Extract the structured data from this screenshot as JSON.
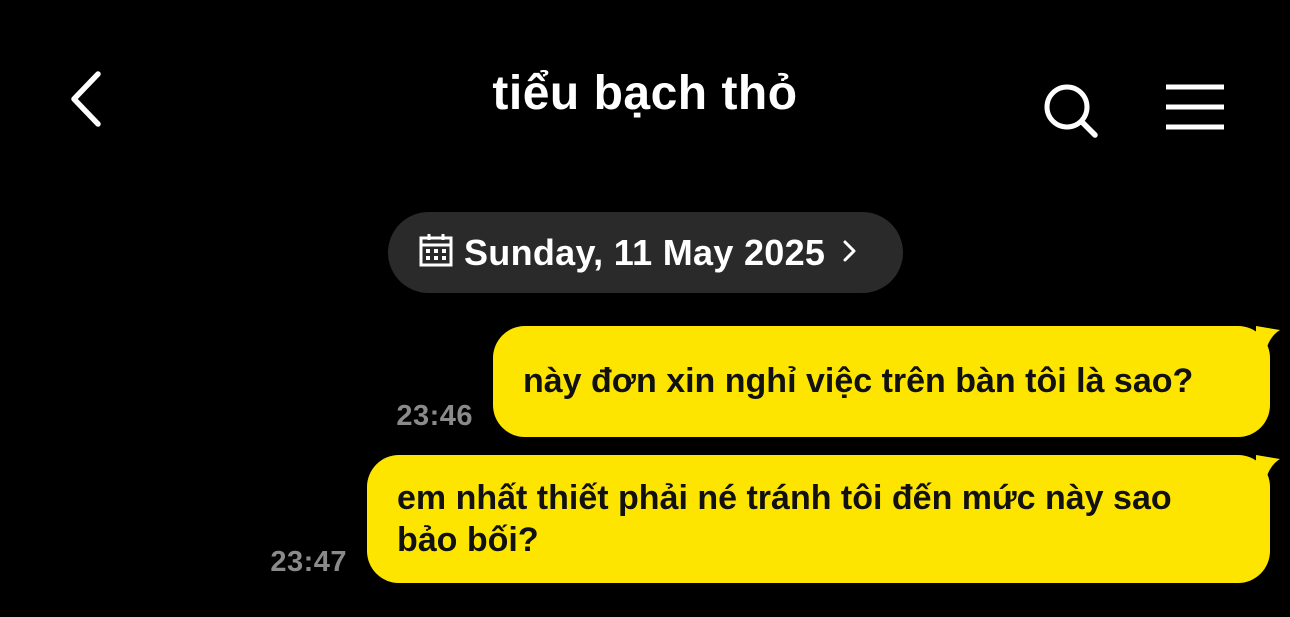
{
  "header": {
    "title": "tiểu bạch thỏ",
    "back_icon": "chevron-left-icon",
    "search_icon": "search-icon",
    "menu_icon": "hamburger-menu-icon"
  },
  "date_chip": {
    "label": "Sunday, 11 May 2025",
    "icon": "calendar-icon",
    "chevron": "chevron-right-icon"
  },
  "messages": [
    {
      "text": "này đơn xin nghỉ việc trên bàn tôi là sao?",
      "time": "23:46",
      "sender": "me"
    },
    {
      "text": "em nhất thiết phải né tránh tôi đến mức này sao bảo bối?",
      "time": "23:47",
      "sender": "me"
    }
  ],
  "colors": {
    "background": "#000000",
    "bubble_mine": "#fee500",
    "chip_background": "#2a2a2a",
    "timestamp": "#8a8a8a"
  }
}
